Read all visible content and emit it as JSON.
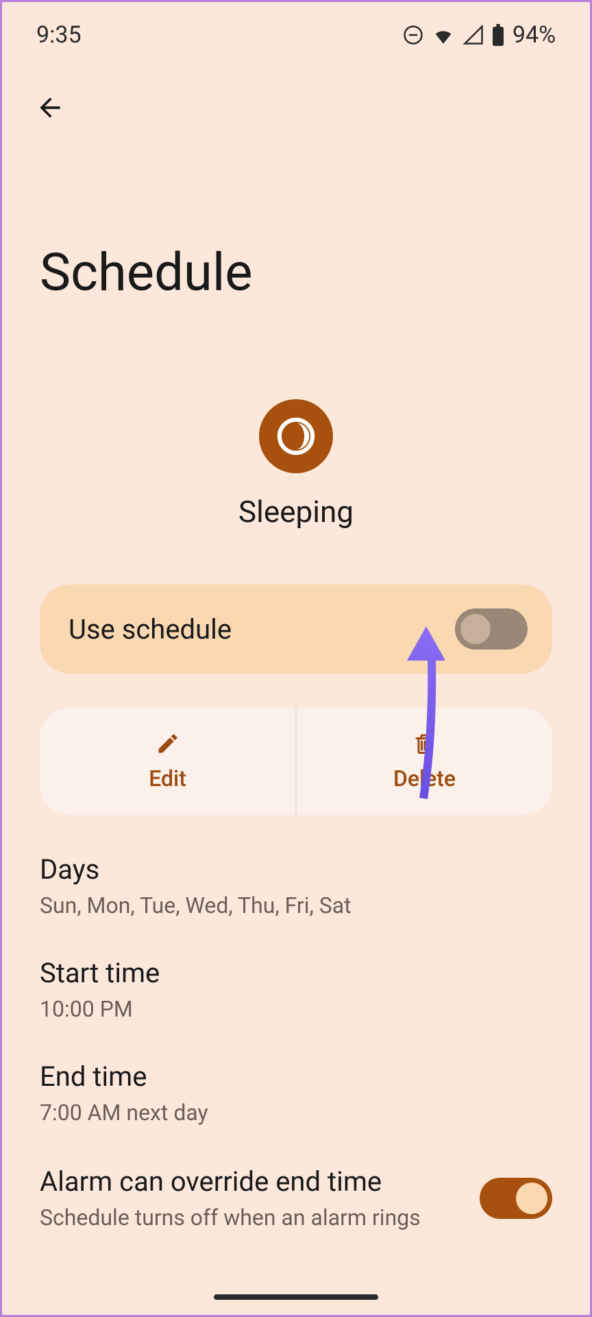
{
  "status": {
    "time": "9:35",
    "battery": "94%"
  },
  "page": {
    "title": "Schedule"
  },
  "mode": {
    "label": "Sleeping"
  },
  "useSchedule": {
    "label": "Use schedule",
    "enabled": false
  },
  "actions": {
    "edit": "Edit",
    "delete": "Delete"
  },
  "settings": {
    "days": {
      "title": "Days",
      "value": "Sun, Mon, Tue, Wed, Thu, Fri, Sat"
    },
    "startTime": {
      "title": "Start time",
      "value": "10:00 PM"
    },
    "endTime": {
      "title": "End time",
      "value": "7:00 AM next day"
    }
  },
  "alarm": {
    "title": "Alarm can override end time",
    "subtitle": "Schedule turns off when an alarm rings",
    "enabled": true
  }
}
